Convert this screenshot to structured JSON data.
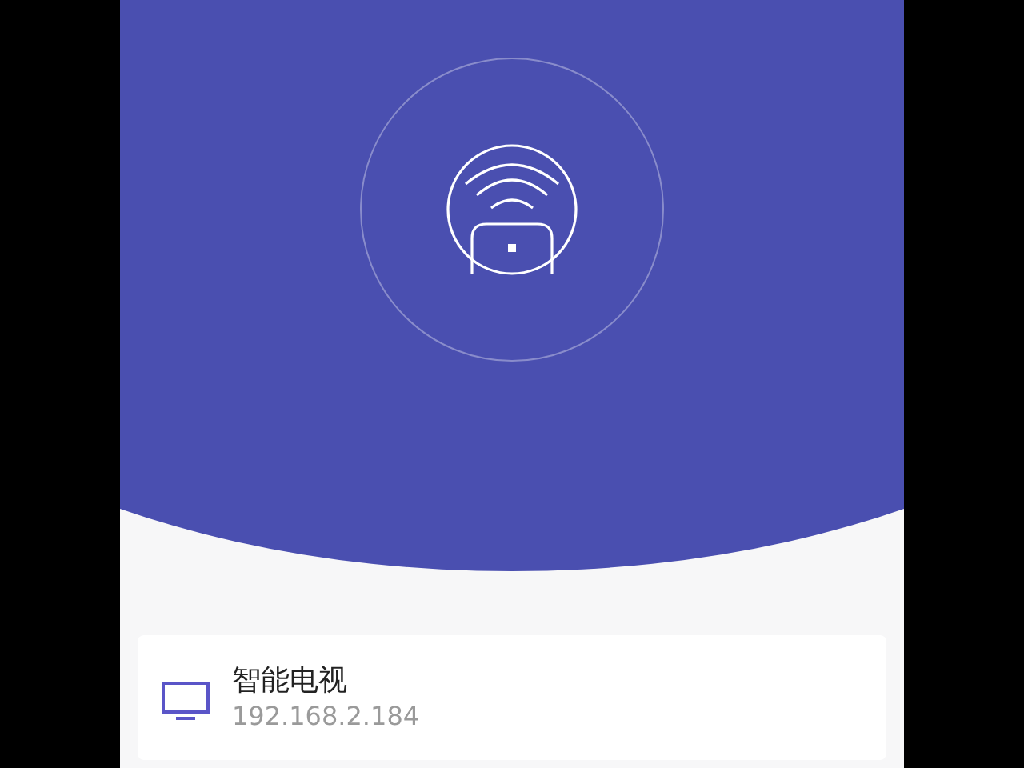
{
  "devices": [
    {
      "kind": "tv",
      "name": "智能电视",
      "ip": "192.168.2.184"
    }
  ]
}
